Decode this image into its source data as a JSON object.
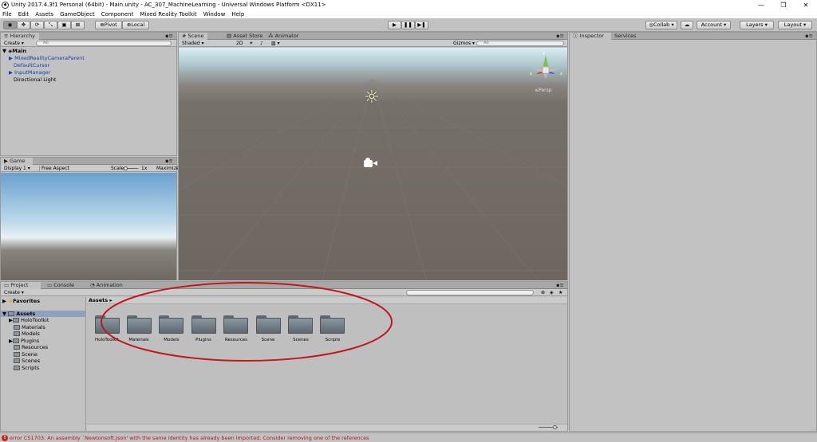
{
  "window": {
    "title": "Unity 2017.4.3f1 Personal (64bit) - Main.unity - AC_307_MachineLearning - Universal Windows Platform <DX11>"
  },
  "menu": [
    "File",
    "Edit",
    "Assets",
    "GameObject",
    "Component",
    "Mixed Reality Toolkit",
    "Window",
    "Help"
  ],
  "toolbar": {
    "pivot": "Pivot",
    "local": "Local",
    "collab": "Collab",
    "account": "Account",
    "layers": "Layers",
    "layout": "Layout"
  },
  "hierarchy": {
    "tab": "Hierarchy",
    "create": "Create",
    "search": "All",
    "scene": "Main",
    "items": [
      "MixedRealityCameraParent",
      "DefaultCursor",
      "InputManager",
      "Directional Light"
    ]
  },
  "game": {
    "tab": "Game",
    "display": "Display 1",
    "aspect": "Free Aspect",
    "scale_label": "Scale",
    "scale_value": "1x",
    "maximize": "Maximize"
  },
  "scene": {
    "tabs": [
      "Scene",
      "Asset Store",
      "Animator"
    ],
    "shading": "Shaded",
    "mode2d": "2D",
    "gizmos": "Gizmos",
    "search": "All",
    "persp": "Persp",
    "axes": {
      "y": "y",
      "x": "x",
      "z": "z"
    }
  },
  "inspector": {
    "tabs": [
      "Inspector",
      "Services"
    ]
  },
  "project": {
    "tabs": [
      "Project",
      "Console",
      "Animation"
    ],
    "create": "Create",
    "favorites": "Favorites",
    "assets_label": "Assets",
    "breadcrumb": "Assets",
    "tree": [
      "HoloToolkit",
      "Materials",
      "Models",
      "Plugins",
      "Resources",
      "Scene",
      "Scenes",
      "Scripts"
    ],
    "folders": [
      "HoloToolkit",
      "Materials",
      "Models",
      "Plugins",
      "Resources",
      "Scene",
      "Scenes",
      "Scripts"
    ]
  },
  "status": {
    "error": "error CS1703: An assembly `Newtonsoft.Json' with the same identity has already been imported. Consider removing one of the references"
  },
  "colors": {
    "highlight_ellipse": "#c0181b",
    "error_icon": "#cc2222"
  }
}
